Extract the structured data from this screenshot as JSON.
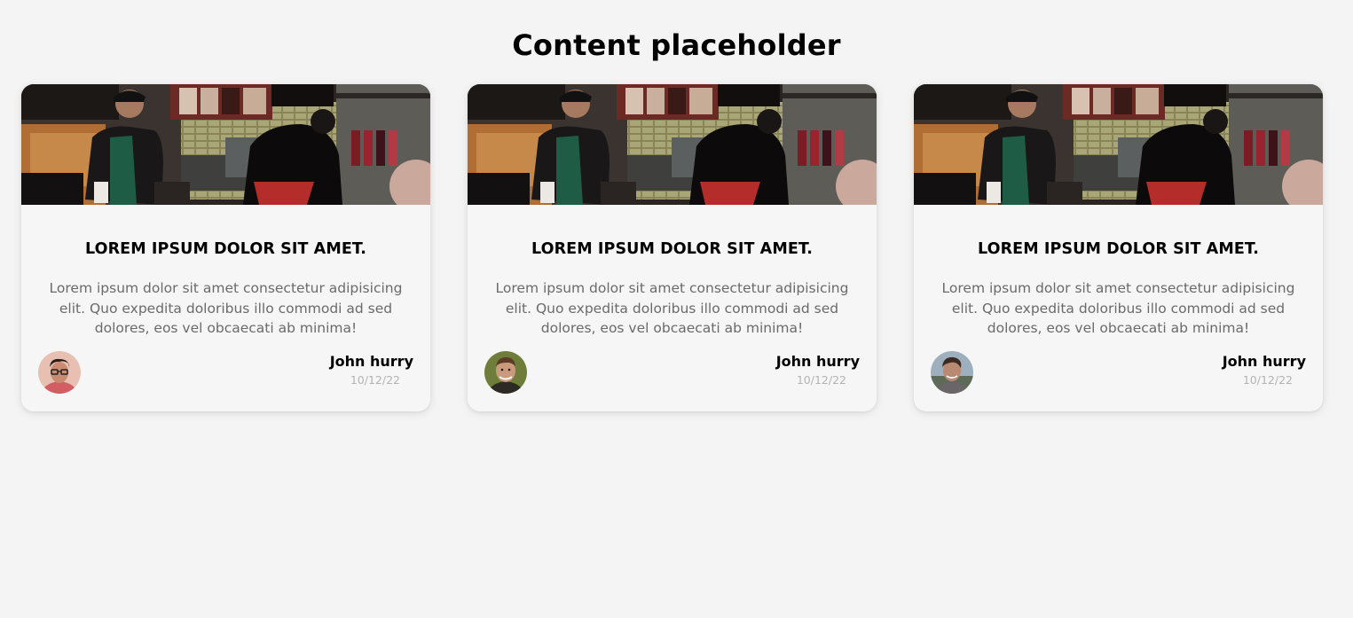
{
  "page": {
    "title": "Content placeholder"
  },
  "cards": [
    {
      "title": "LOREM IPSUM DOLOR SIT AMET.",
      "text": "Lorem ipsum dolor sit amet consectetur adipisicing elit. Quo expedita doloribus illo commodi ad sed dolores, eos vel obcaecati ab minima!",
      "author": "John hurry",
      "date": "10/12/22"
    },
    {
      "title": "LOREM IPSUM DOLOR SIT AMET.",
      "text": "Lorem ipsum dolor sit amet consectetur adipisicing elit. Quo expedita doloribus illo commodi ad sed dolores, eos vel obcaecati ab minima!",
      "author": "John hurry",
      "date": "10/12/22"
    },
    {
      "title": "LOREM IPSUM DOLOR SIT AMET.",
      "text": "Lorem ipsum dolor sit amet consectetur adipisicing elit. Quo expedita doloribus illo commodi ad sed dolores, eos vel obcaecati ab minima!",
      "author": "John hurry",
      "date": "10/12/22"
    }
  ]
}
